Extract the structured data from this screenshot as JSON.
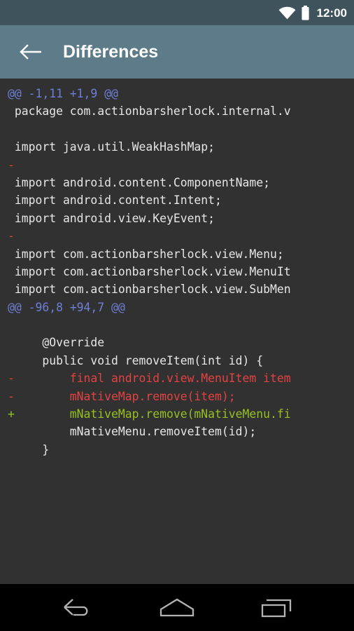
{
  "status_bar": {
    "clock": "12:00",
    "wifi_icon": "wifi-icon",
    "battery_icon": "battery-icon",
    "background_color": "#3f535d"
  },
  "app_bar": {
    "title": "Differences",
    "back_icon": "arrow-back-icon",
    "background_color": "#5d7b88",
    "title_color": "#ffffff"
  },
  "diff": {
    "background_color": "#313131",
    "colors": {
      "context": "#e6e6e6",
      "deletion": "#e34242",
      "addition": "#97c020",
      "hunk_header": "#6f7fd6"
    },
    "lines": [
      {
        "type": "hunk",
        "text": "@@ -1,11 +1,9 @@"
      },
      {
        "type": "ctx",
        "text": " package com.actionbarsherlock.internal.v"
      },
      {
        "type": "ctx",
        "text": ""
      },
      {
        "type": "ctx",
        "text": " import java.util.WeakHashMap;"
      },
      {
        "type": "del",
        "text": "-"
      },
      {
        "type": "ctx",
        "text": " import android.content.ComponentName;"
      },
      {
        "type": "ctx",
        "text": " import android.content.Intent;"
      },
      {
        "type": "ctx",
        "text": " import android.view.KeyEvent;"
      },
      {
        "type": "del",
        "text": "-"
      },
      {
        "type": "ctx",
        "text": " import com.actionbarsherlock.view.Menu;"
      },
      {
        "type": "ctx",
        "text": " import com.actionbarsherlock.view.MenuIt"
      },
      {
        "type": "ctx",
        "text": " import com.actionbarsherlock.view.SubMen"
      },
      {
        "type": "hunk",
        "text": "@@ -96,8 +94,7 @@"
      },
      {
        "type": "ctx",
        "text": ""
      },
      {
        "type": "ctx",
        "text": "     @Override"
      },
      {
        "type": "ctx",
        "text": "     public void removeItem(int id) {"
      },
      {
        "type": "del",
        "text": "-        final android.view.MenuItem item"
      },
      {
        "type": "del",
        "text": "-        mNativeMap.remove(item);"
      },
      {
        "type": "add",
        "text": "+        mNativeMap.remove(mNativeMenu.fi"
      },
      {
        "type": "ctx",
        "text": "         mNativeMenu.removeItem(id);"
      },
      {
        "type": "ctx",
        "text": "     }"
      }
    ]
  },
  "nav_bar": {
    "background_color": "#000000",
    "keys": [
      {
        "name": "back-nav-icon",
        "label": "Back"
      },
      {
        "name": "home-nav-icon",
        "label": "Home"
      },
      {
        "name": "recents-nav-icon",
        "label": "Recents"
      }
    ]
  }
}
